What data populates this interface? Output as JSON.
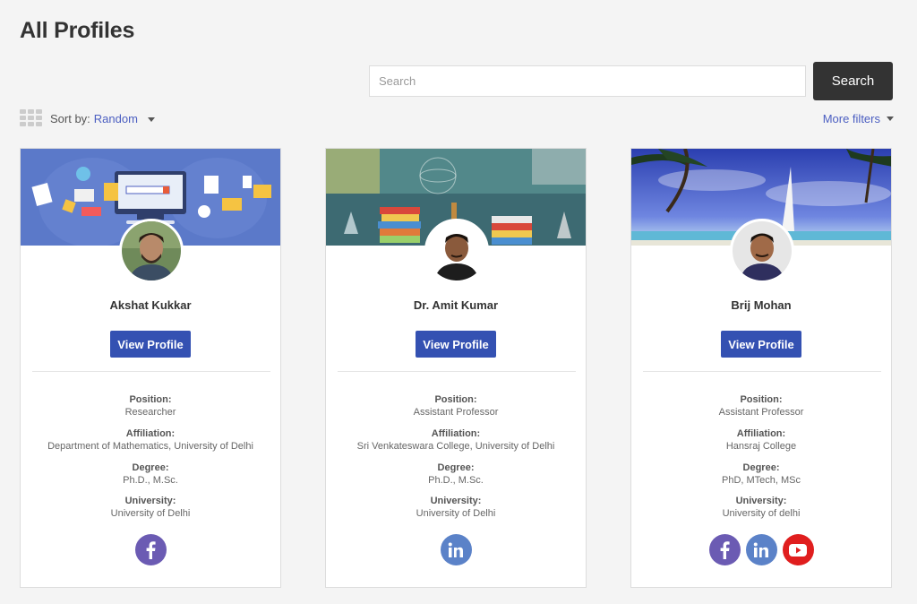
{
  "page": {
    "title": "All Profiles"
  },
  "search": {
    "placeholder": "Search",
    "button_label": "Search"
  },
  "sort": {
    "label": "Sort by:",
    "value": "Random"
  },
  "filters": {
    "label": "More filters"
  },
  "labels": {
    "position": "Position:",
    "affiliation": "Affiliation:",
    "degree": "Degree:",
    "university": "University:"
  },
  "profiles": [
    {
      "name": "Akshat Kukkar",
      "button": "View Profile",
      "position": "Researcher",
      "affiliation": "Department of Mathematics, University of Delhi",
      "degree": "Ph.D., M.Sc.",
      "university": "University of Delhi",
      "socials": [
        "facebook-icon"
      ]
    },
    {
      "name": "Dr. Amit Kumar",
      "button": "View Profile",
      "position": "Assistant Professor",
      "affiliation": "Sri Venkateswara College, University of Delhi",
      "degree": "Ph.D., M.Sc.",
      "university": "University of Delhi",
      "socials": [
        "linkedin-icon"
      ]
    },
    {
      "name": "Brij Mohan",
      "button": "View Profile",
      "position": "Assistant Professor",
      "affiliation": "Hansraj College",
      "degree": "PhD, MTech, MSc",
      "university": "University of delhi",
      "socials": [
        "facebook-icon",
        "linkedin-icon",
        "youtube-icon"
      ]
    }
  ],
  "colors": {
    "accent": "#3451b2",
    "link": "#4b5ec1",
    "search_button": "#333333",
    "facebook": "#6b5bb3",
    "linkedin": "#5b82c8",
    "youtube": "#e01e1e"
  }
}
